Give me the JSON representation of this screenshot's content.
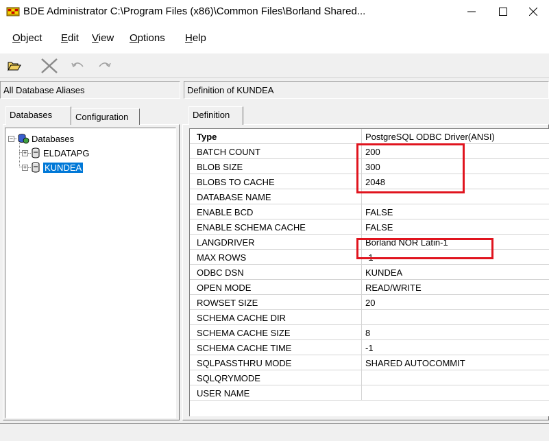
{
  "window": {
    "title": "BDE Administrator  C:\\Program Files (x86)\\Common Files\\Borland Shared...",
    "app_icon": "bde-admin-icon",
    "controls": {
      "minimize": "—",
      "maximize": "☐",
      "close": "✕"
    }
  },
  "menu": [
    {
      "label_ul": "O",
      "label_rest": "bject"
    },
    {
      "label_ul": "E",
      "label_rest": "dit"
    },
    {
      "label_ul": "V",
      "label_rest": "iew"
    },
    {
      "label_ul": "O",
      "label_rest": "ptions"
    },
    {
      "label_ul": "H",
      "label_rest": "elp"
    }
  ],
  "toolbar": {
    "icons": [
      "open-folder-icon",
      "delete-icon",
      "undo-icon",
      "redo-icon"
    ]
  },
  "left_pane": {
    "header": "All Database Aliases",
    "tabs": [
      "Databases",
      "Configuration"
    ],
    "tree": {
      "root": {
        "label": "Databases",
        "expander": "−"
      },
      "children": [
        {
          "label": "ELDATAPG",
          "expander": "+",
          "selected": false
        },
        {
          "label": "KUNDEA",
          "expander": "+",
          "selected": true
        }
      ]
    }
  },
  "right_pane": {
    "header": "Definition of KUNDEA",
    "tabs": [
      "Definition"
    ],
    "grid": {
      "header": {
        "name": "Type",
        "value": "PostgreSQL ODBC Driver(ANSI)"
      },
      "rows": [
        {
          "name": "BATCH COUNT",
          "value": "200"
        },
        {
          "name": "BLOB SIZE",
          "value": "300"
        },
        {
          "name": "BLOBS TO CACHE",
          "value": "2048"
        },
        {
          "name": "DATABASE NAME",
          "value": ""
        },
        {
          "name": "ENABLE BCD",
          "value": "FALSE"
        },
        {
          "name": "ENABLE SCHEMA CACHE",
          "value": "FALSE"
        },
        {
          "name": "LANGDRIVER",
          "value": "Borland NOR Latin-1"
        },
        {
          "name": "MAX ROWS",
          "value": "-1"
        },
        {
          "name": "ODBC DSN",
          "value": "KUNDEA"
        },
        {
          "name": "OPEN MODE",
          "value": "READ/WRITE"
        },
        {
          "name": "ROWSET SIZE",
          "value": "20"
        },
        {
          "name": "SCHEMA CACHE DIR",
          "value": ""
        },
        {
          "name": "SCHEMA CACHE SIZE",
          "value": "8"
        },
        {
          "name": "SCHEMA CACHE TIME",
          "value": "-1"
        },
        {
          "name": "SQLPASSTHRU MODE",
          "value": "SHARED AUTOCOMMIT"
        },
        {
          "name": "SQLQRYMODE",
          "value": ""
        },
        {
          "name": "USER NAME",
          "value": ""
        }
      ]
    }
  },
  "annotation_color": "#e0141e",
  "selection_color": "#0078d7"
}
